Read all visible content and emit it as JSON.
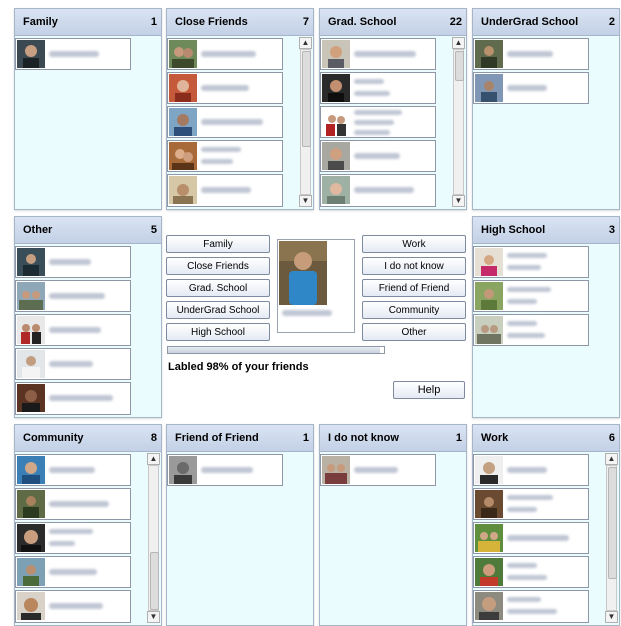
{
  "groups": {
    "family": {
      "title": "Family",
      "count": "1"
    },
    "close_friends": {
      "title": "Close Friends",
      "count": "7"
    },
    "grad_school": {
      "title": "Grad. School",
      "count": "22"
    },
    "undergrad": {
      "title": "UnderGrad School",
      "count": "2"
    },
    "other": {
      "title": "Other",
      "count": "5"
    },
    "high_school": {
      "title": "High School",
      "count": "3"
    },
    "community": {
      "title": "Community",
      "count": "8"
    },
    "friend_of_friend": {
      "title": "Friend of Friend",
      "count": "1"
    },
    "i_do_not_know": {
      "title": "I do not know",
      "count": "1"
    },
    "work": {
      "title": "Work",
      "count": "6"
    }
  },
  "center": {
    "left_buttons": [
      "Family",
      "Close Friends",
      "Grad. School",
      "UnderGrad School",
      "High School"
    ],
    "right_buttons": [
      "Work",
      "I do not know",
      "Friend of Friend",
      "Community",
      "Other"
    ],
    "status_text": "Labled 98% of your friends",
    "progress_fraction": 0.98,
    "help_label": "Help"
  },
  "scroll_arrows": {
    "up": "▲",
    "down": "▼"
  },
  "colors": {
    "panel_bg": "#eafcfd",
    "header_bg": "#c9d5ea",
    "border": "#a7b5c9"
  },
  "icons": [
    "friend-photo",
    "scroll-up-icon",
    "scroll-down-icon"
  ]
}
